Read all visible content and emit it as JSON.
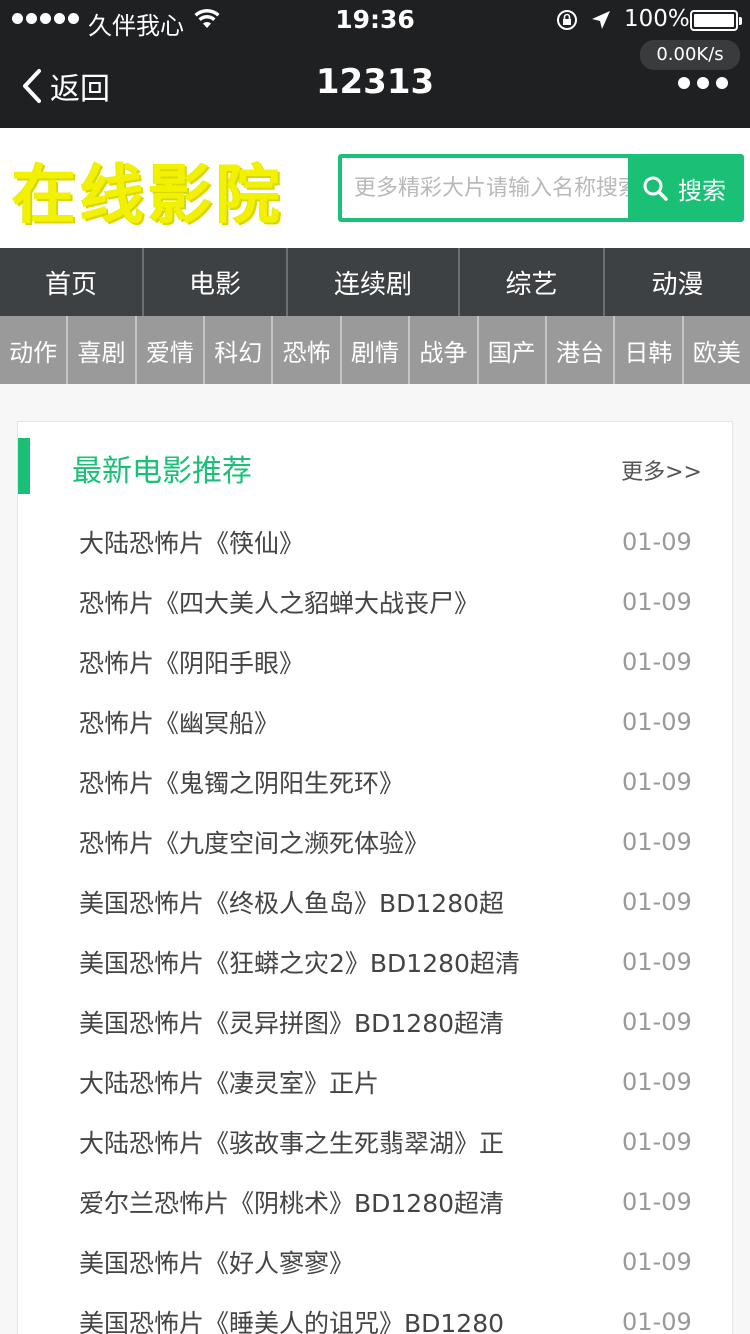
{
  "status_bar": {
    "carrier": "久伴我心",
    "time": "19:36",
    "battery": "100%",
    "net_speed": "0.00K/s"
  },
  "nav_bar": {
    "back_label": "返回",
    "title": "12313"
  },
  "header": {
    "logo_text": "在线影院",
    "search_placeholder": "更多精彩大片请输入名称搜索",
    "search_button": "搜索",
    "accent_color": "#1bc077"
  },
  "main_nav": [
    {
      "label": "首页"
    },
    {
      "label": "电影"
    },
    {
      "label": "连续剧"
    },
    {
      "label": "综艺"
    },
    {
      "label": "动漫"
    }
  ],
  "sub_nav": [
    {
      "label": "动作"
    },
    {
      "label": "喜剧"
    },
    {
      "label": "爱情"
    },
    {
      "label": "科幻"
    },
    {
      "label": "恐怖"
    },
    {
      "label": "剧情"
    },
    {
      "label": "战争"
    },
    {
      "label": "国产"
    },
    {
      "label": "港台"
    },
    {
      "label": "日韩"
    },
    {
      "label": "欧美"
    }
  ],
  "section": {
    "title": "最新电影推荐",
    "more": "更多>>",
    "items": [
      {
        "title": "大陆恐怖片《筷仙》",
        "date": "01-09"
      },
      {
        "title": "恐怖片《四大美人之貂蝉大战丧尸》",
        "date": "01-09"
      },
      {
        "title": "恐怖片《阴阳手眼》",
        "date": "01-09"
      },
      {
        "title": "恐怖片《幽冥船》",
        "date": "01-09"
      },
      {
        "title": "恐怖片《鬼镯之阴阳生死环》",
        "date": "01-09"
      },
      {
        "title": "恐怖片《九度空间之濒死体验》",
        "date": "01-09"
      },
      {
        "title": "美国恐怖片《终极人鱼岛》BD1280超",
        "date": "01-09"
      },
      {
        "title": "美国恐怖片《狂蟒之灾2》BD1280超清",
        "date": "01-09"
      },
      {
        "title": "美国恐怖片《灵异拼图》BD1280超清",
        "date": "01-09"
      },
      {
        "title": "大陆恐怖片《凄灵室》正片",
        "date": "01-09"
      },
      {
        "title": "大陆恐怖片《骇故事之生死翡翠湖》正",
        "date": "01-09"
      },
      {
        "title": "爱尔兰恐怖片《阴桃术》BD1280超清",
        "date": "01-09"
      },
      {
        "title": "美国恐怖片《好人寥寥》",
        "date": "01-09"
      },
      {
        "title": "美国恐怖片《睡美人的诅咒》BD1280",
        "date": "01-09"
      }
    ]
  }
}
